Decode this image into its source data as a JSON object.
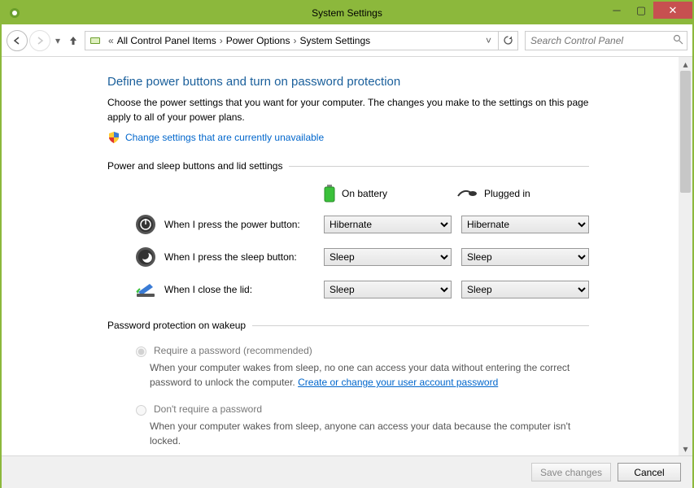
{
  "window": {
    "title": "System Settings"
  },
  "breadcrumb": {
    "prefix": "«",
    "items": [
      "All Control Panel Items",
      "Power Options",
      "System Settings"
    ]
  },
  "search": {
    "placeholder": "Search Control Panel"
  },
  "page": {
    "heading": "Define power buttons and turn on password protection",
    "description": "Choose the power settings that you want for your computer. The changes you make to the settings on this page apply to all of your power plans.",
    "change_link": "Change settings that are currently unavailable"
  },
  "power_section": {
    "title": "Power and sleep buttons and lid settings",
    "col_battery": "On battery",
    "col_plugged": "Plugged in",
    "rows": [
      {
        "label": "When I press the power button:",
        "battery": "Hibernate",
        "plugged": "Hibernate"
      },
      {
        "label": "When I press the sleep button:",
        "battery": "Sleep",
        "plugged": "Sleep"
      },
      {
        "label": "When I close the lid:",
        "battery": "Sleep",
        "plugged": "Sleep"
      }
    ]
  },
  "password_section": {
    "title": "Password protection on wakeup",
    "opt1_label": "Require a password (recommended)",
    "opt1_desc_a": "When your computer wakes from sleep, no one can access your data without entering the correct password to unlock the computer. ",
    "opt1_link": "Create or change your user account password",
    "opt2_label": "Don't require a password",
    "opt2_desc": "When your computer wakes from sleep, anyone can access your data because the computer isn't locked."
  },
  "footer": {
    "save": "Save changes",
    "cancel": "Cancel"
  }
}
